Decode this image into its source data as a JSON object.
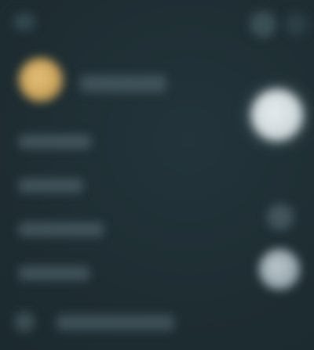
{
  "app": {
    "title": ""
  },
  "colors": {
    "background": "#1f2f35",
    "avatar_gold": "#e8c27a",
    "primary_button": "#dfe7e9",
    "muted_placeholder": "#5f737b"
  },
  "header": {
    "menu_icon": "menu-icon",
    "action_icon_1": "circle-icon",
    "action_icon_2": "circle-icon"
  },
  "profile": {
    "avatar_icon": "avatar",
    "name": ""
  },
  "menu": {
    "items": [
      {
        "label": ""
      },
      {
        "label": ""
      },
      {
        "label": ""
      },
      {
        "label": ""
      }
    ]
  },
  "side_actions": {
    "icon_1": "circle-icon",
    "icon_2": "circle-icon"
  },
  "footer": {
    "icon": "circle-icon",
    "label": ""
  }
}
